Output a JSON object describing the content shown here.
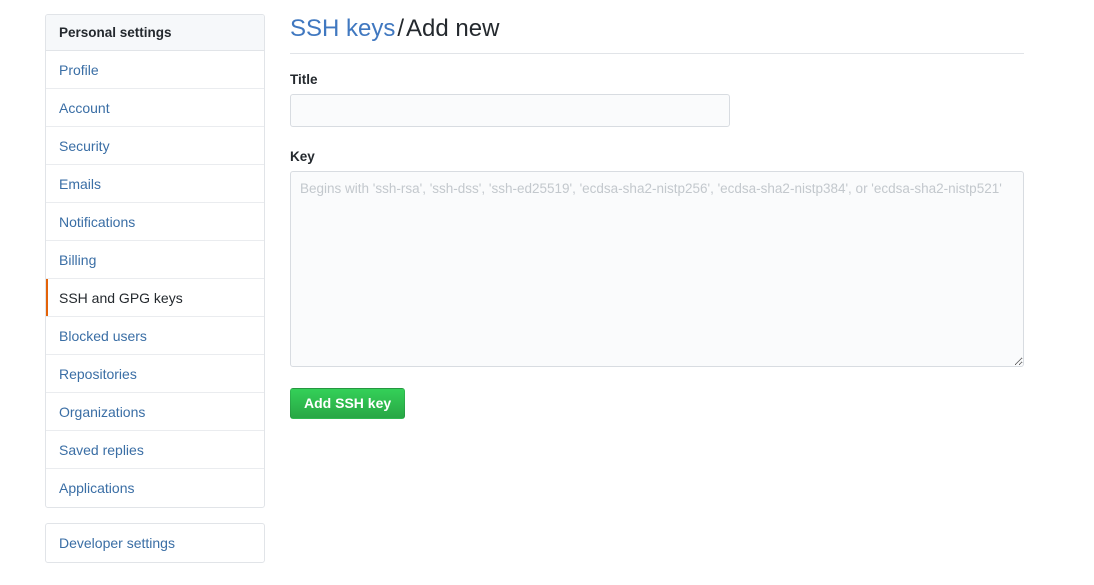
{
  "sidebar": {
    "header": "Personal settings",
    "items": [
      {
        "label": "Profile",
        "active": false
      },
      {
        "label": "Account",
        "active": false
      },
      {
        "label": "Security",
        "active": false
      },
      {
        "label": "Emails",
        "active": false
      },
      {
        "label": "Notifications",
        "active": false
      },
      {
        "label": "Billing",
        "active": false
      },
      {
        "label": "SSH and GPG keys",
        "active": true
      },
      {
        "label": "Blocked users",
        "active": false
      },
      {
        "label": "Repositories",
        "active": false
      },
      {
        "label": "Organizations",
        "active": false
      },
      {
        "label": "Saved replies",
        "active": false
      },
      {
        "label": "Applications",
        "active": false
      }
    ],
    "developer_settings": "Developer settings",
    "active_accent_color": "#e36209",
    "link_color": "#3a6ea5"
  },
  "main": {
    "heading": {
      "parent_link": "SSH keys",
      "separator": "/",
      "current": "Add new"
    },
    "title_field": {
      "label": "Title",
      "value": "",
      "placeholder": ""
    },
    "key_field": {
      "label": "Key",
      "value": "",
      "placeholder": "Begins with 'ssh-rsa', 'ssh-dss', 'ssh-ed25519', 'ecdsa-sha2-nistp256', 'ecdsa-sha2-nistp384', or 'ecdsa-sha2-nistp521'"
    },
    "submit_button": {
      "label": "Add SSH key",
      "color": "#2cbe4e"
    }
  }
}
